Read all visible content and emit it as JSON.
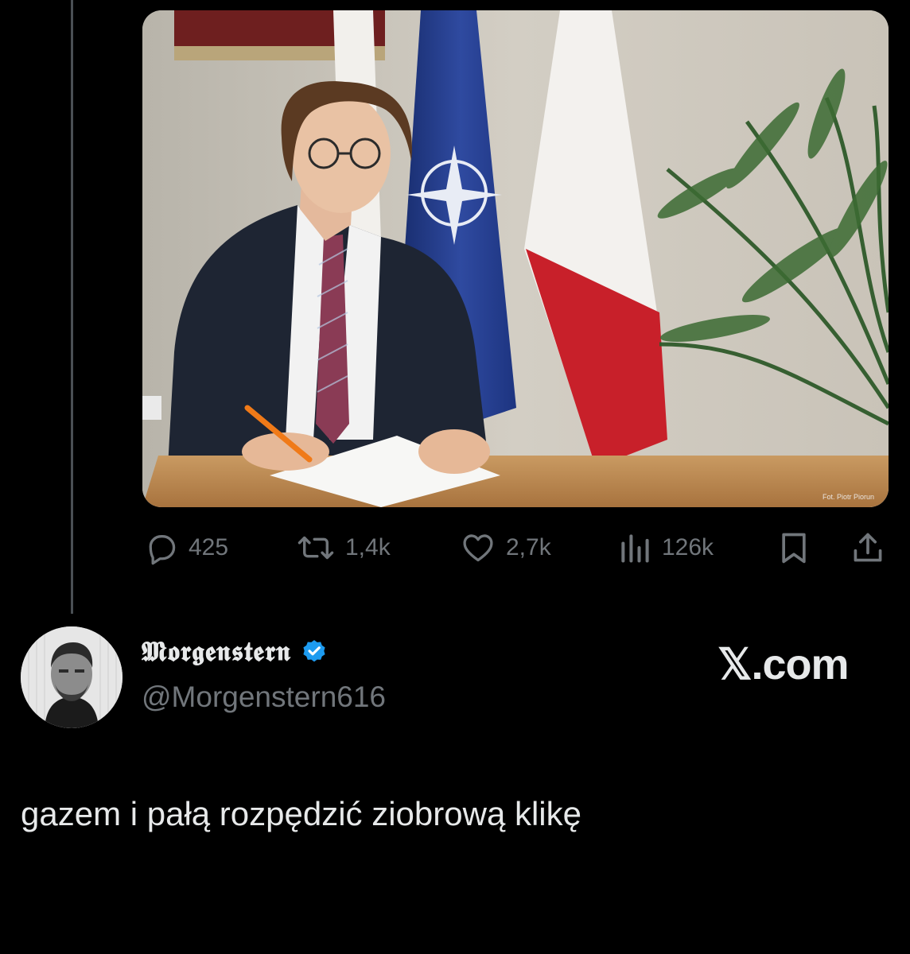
{
  "post": {
    "media": {
      "photo_credit": "Fot. Piotr Piorun"
    },
    "actions": {
      "replies": "425",
      "reposts": "1,4k",
      "likes": "2,7k",
      "views": "126k"
    }
  },
  "quote": {
    "author_name": "𝕸𝖔𝖗𝖌𝖊𝖓𝖘𝖙𝖊𝖗𝖓",
    "handle": "@Morgenstern616",
    "verified": true,
    "brand": "𝕏.com",
    "text": "gazem i pałą rozpędzić ziobrową klikę"
  },
  "icons": {
    "reply": "reply-icon",
    "repost": "repost-icon",
    "like": "heart-icon",
    "views": "views-icon",
    "bookmark": "bookmark-icon",
    "share": "share-icon",
    "verified": "verified-badge-icon"
  },
  "colors": {
    "background": "#000000",
    "text": "#e7e9ea",
    "muted": "#71767b",
    "verified": "#1d9bf0",
    "thread_line": "#4a4f54"
  }
}
